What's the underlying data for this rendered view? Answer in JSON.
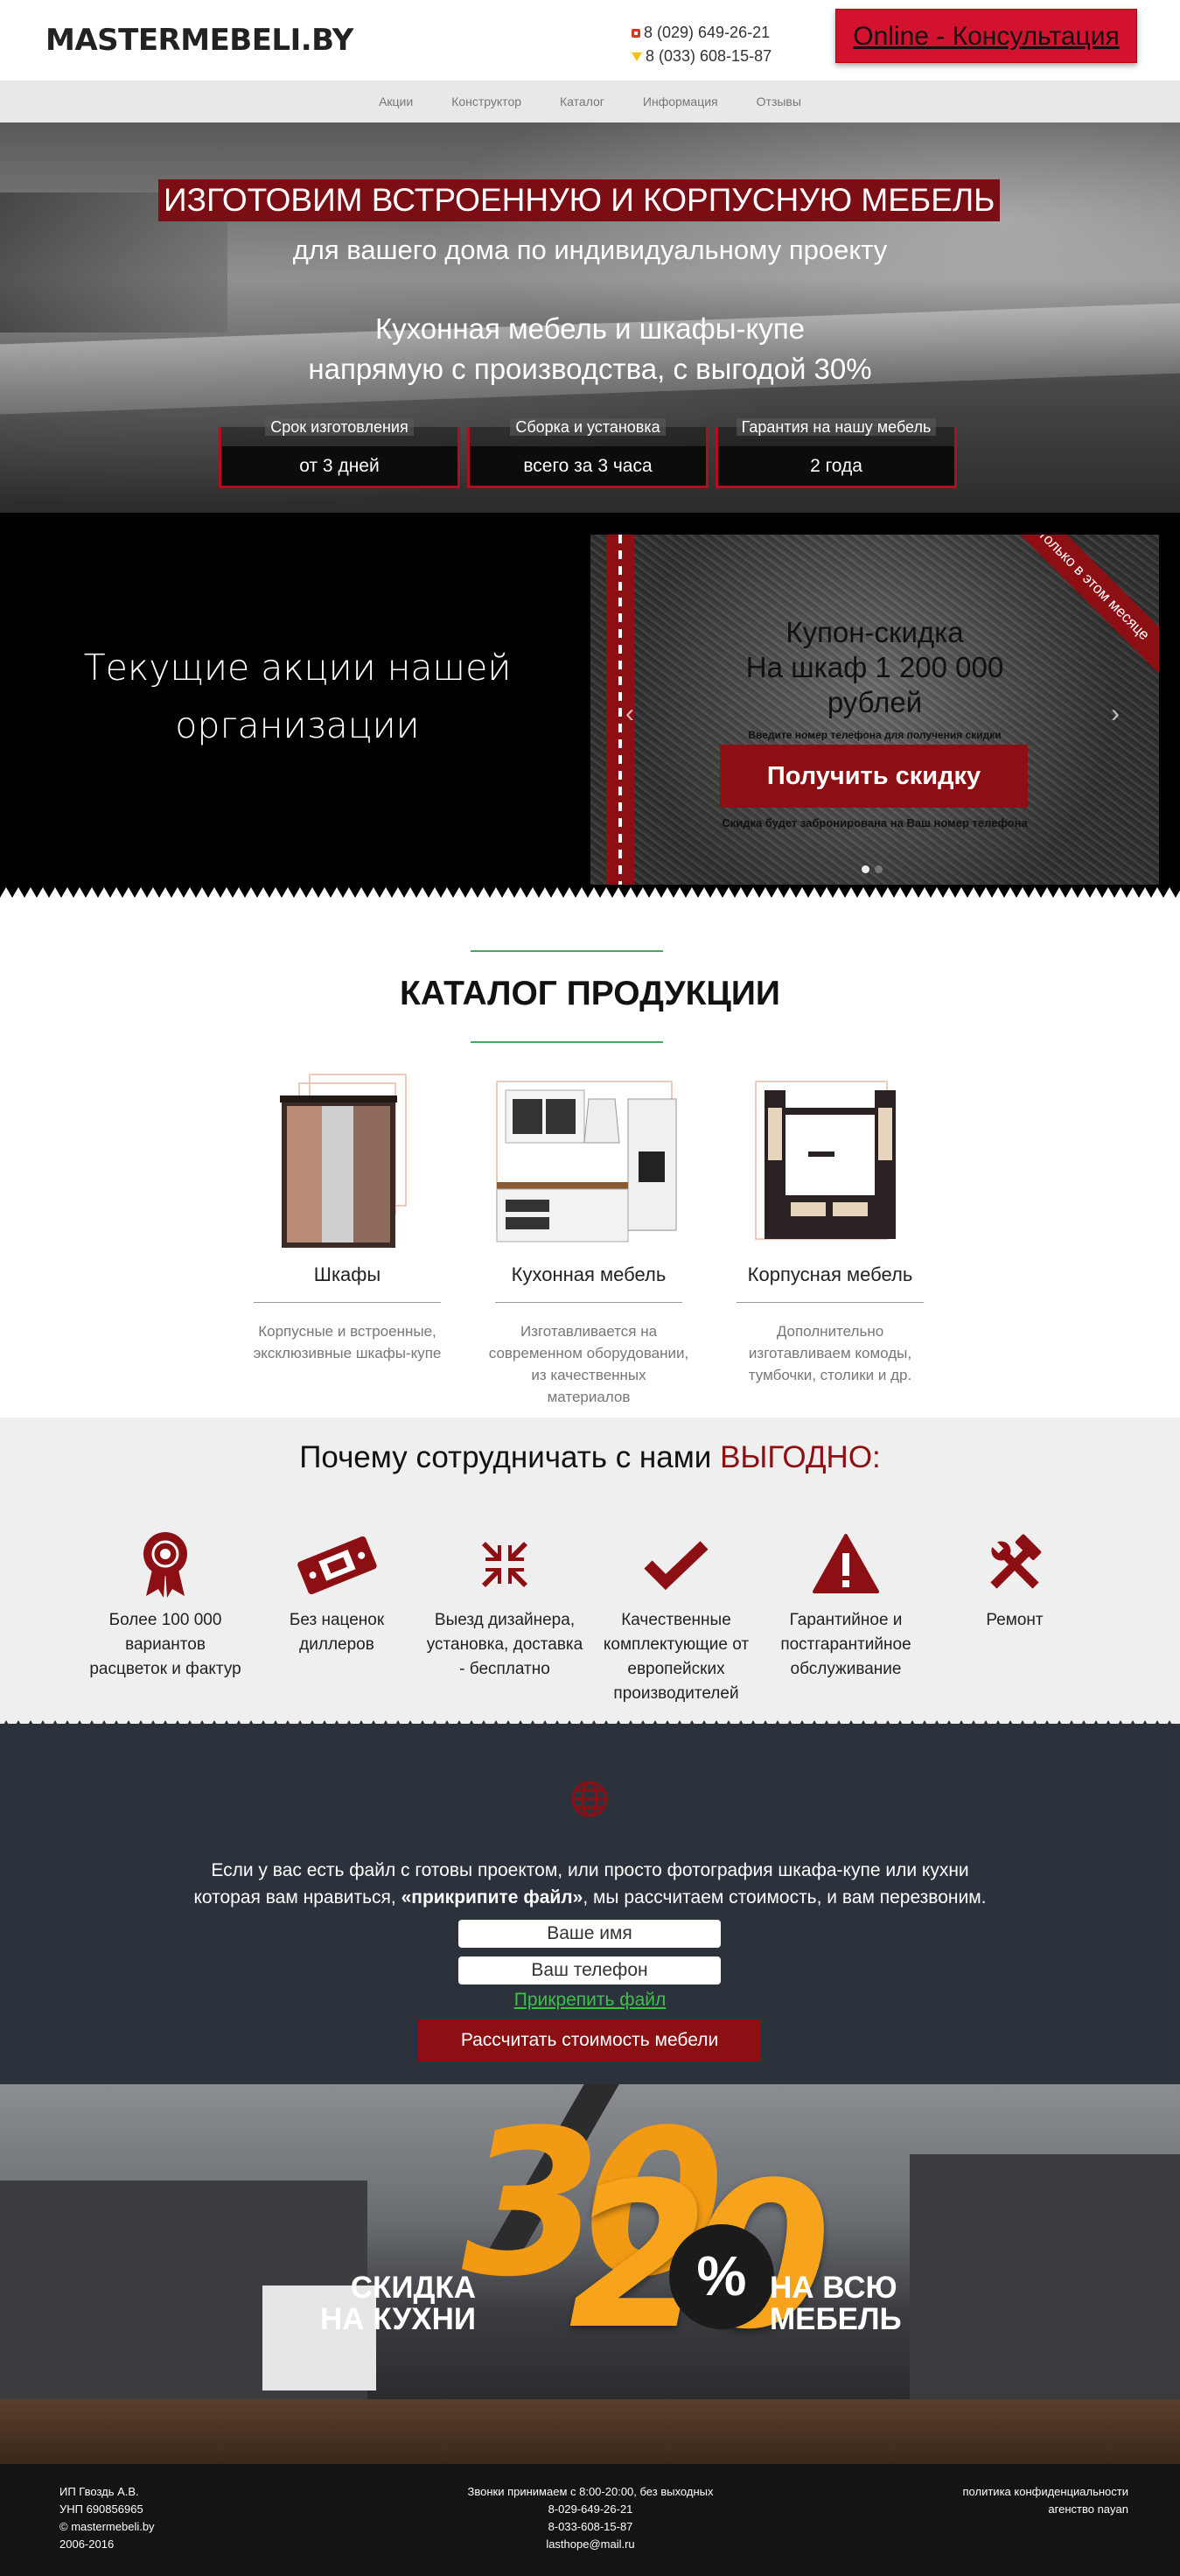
{
  "header": {
    "logo": "MASTERMEBELI.BY",
    "phone1": "8 (029) 649-26-21",
    "phone2": "8 (033) 608-15-87",
    "consult_label": "Online - Консультация"
  },
  "nav": [
    "Акции",
    "Конструктор",
    "Каталог",
    "Информация",
    "Отзывы"
  ],
  "hero": {
    "title": "ИЗГОТОВИМ ВСТРОЕННУЮ И КОРПУСНУЮ МЕБЕЛЬ",
    "subtitle": "для вашего дома по индивидуальному проекту",
    "line1": "Кухонная мебель и шкафы-купе",
    "line2": "напрямую с производства, с выгодой 30%",
    "boxes": [
      {
        "label": "Срок изготовления",
        "value": "от 3 дней"
      },
      {
        "label": "Сборка и установка",
        "value": "всего за 3 часа"
      },
      {
        "label": "Гарантия на нашу мебель",
        "value": "2 года"
      }
    ]
  },
  "promo": {
    "line1": "Текущие акции нашей",
    "line2": "организации",
    "coupon": {
      "ribbon": "Только в этом месяце",
      "title1": "Купон-скидка",
      "title2": "На шкаф 1 200 000",
      "title3": "рублей",
      "hint": "Введите номер телефона для получения скидки",
      "button": "Получить скидку",
      "note": "Скидка будет забронирована на Ваш номер телефона",
      "prev": "‹",
      "next": "›"
    }
  },
  "catalog": {
    "title": "КАТАЛОГ ПРОДУКЦИИ",
    "items": [
      {
        "name": "Шкафы",
        "desc1": "Корпусные и встроенные,",
        "desc2": "эксклюзивные шкафы-купе",
        "desc3": ""
      },
      {
        "name": "Кухонная мебель",
        "desc1": "Изготавливается на",
        "desc2": "современном оборудовании,",
        "desc3": "из качественных материалов"
      },
      {
        "name": "Корпусная мебель",
        "desc1": "Дополнительно",
        "desc2": "изготавливаем комоды,",
        "desc3": "тумбочки, столики и др."
      }
    ]
  },
  "why": {
    "title": "Почему сотрудничать с нами ",
    "accent": "ВЫГОДНО",
    "colon": ":",
    "accent_color": "#8c0f14",
    "items": [
      {
        "icon": "award-icon",
        "l1": "Более 100 000",
        "l2": "вариантов",
        "l3": "расцветок и фактур",
        "l4": ""
      },
      {
        "icon": "ticket-icon",
        "l1": "Без наценок",
        "l2": "диллеров",
        "l3": "",
        "l4": ""
      },
      {
        "icon": "compress-icon",
        "l1": "Выезд дизайнера,",
        "l2": "установка, доставка",
        "l3": "- бесплатно",
        "l4": ""
      },
      {
        "icon": "check-icon",
        "l1": "Качественные",
        "l2": "комплектующие от",
        "l3": "европейских",
        "l4": "производителей"
      },
      {
        "icon": "warning-icon",
        "l1": "Гарантийное и",
        "l2": "постгарантийное",
        "l3": "обслуживание",
        "l4": ""
      },
      {
        "icon": "tools-icon",
        "l1": "Ремонт",
        "l2": "",
        "l3": "",
        "l4": ""
      }
    ]
  },
  "form": {
    "text1": "Если у вас есть файл с готовы проектом, или просто фотография шкафа-купе или кухни",
    "text2a": "которая вам нравиться, ",
    "text2b": "«прикрипите файл»",
    "text2c": ", мы рассчитаем стоимость, и вам перезвоним.",
    "name_placeholder": "Ваше имя",
    "phone_placeholder": "Ваш телефон",
    "attach": "Прикрепить файл",
    "submit": "Рассчитать стоимость мебели"
  },
  "banner": {
    "left1": "СКИДКА",
    "left2": "НА КУХНИ",
    "n30": "30",
    "n20": "20",
    "pct": "%",
    "right1": "НА ВСЮ",
    "right2": "МЕБЕЛЬ"
  },
  "footer": {
    "left": [
      "ИП Гвоздь А.В.",
      "УНП 690856965",
      "© mastermebeli.by",
      "2006-2016"
    ],
    "mid": [
      "Звонки принимаем с 8:00-20:00, без выходных",
      "8-029-649-26-21",
      "8-033-608-15-87",
      "lasthope@mail.ru"
    ],
    "right": [
      "политика конфиденциальности",
      "агенство nayan"
    ]
  }
}
